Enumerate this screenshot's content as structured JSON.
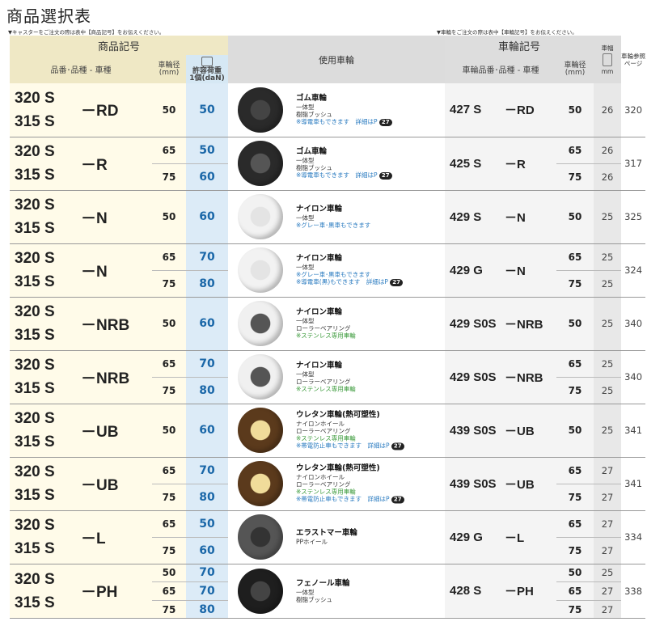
{
  "title": "商品選択表",
  "note_left": "▼キャスターをご注文の際は表中【商品記号】をお伝えください。",
  "note_right": "▼車輪をご注文の際は表中【車輪記号】をお伝えください。",
  "header": {
    "product_code": "商品記号",
    "product_sub": "品番･品種 - 車種",
    "wheel_dia": "車輪径",
    "wheel_dia_unit": "(mm)",
    "load": "許容荷重",
    "load_unit": "1個(daN)",
    "wheel_used": "使用車輪",
    "wheel_code": "車輪記号",
    "wheel_sub": "車輪品番･品種 - 車種",
    "wheel_dia2": "車輪径",
    "wheel_dia2_unit": "(mm)",
    "width": "車幅",
    "width_unit": "mm",
    "ref": "車輪参照ページ"
  },
  "models": [
    "320 S",
    "315 S"
  ],
  "groups": [
    {
      "type": "－RD",
      "sizes": [
        "50"
      ],
      "loads": [
        "50"
      ],
      "wheel_name": "ゴム車輪",
      "lines": [
        "一体型",
        "樹脂ブッシュ"
      ],
      "blue": [
        "※導電車もできます　詳細はP"
      ],
      "badge": "27",
      "green": [],
      "color": "#2a2a2a",
      "hub": "#444",
      "wmodel": "427 S",
      "wtype": "－RD",
      "wsizes": [
        "50"
      ],
      "widths": [
        "26"
      ],
      "page": "320"
    },
    {
      "type": "－R",
      "sizes": [
        "65",
        "75"
      ],
      "loads": [
        "50",
        "60"
      ],
      "wheel_name": "ゴム車輪",
      "lines": [
        "一体型",
        "樹脂ブッシュ"
      ],
      "blue": [
        "※導電車もできます　詳細はP"
      ],
      "badge": "27",
      "green": [],
      "color": "#2a2a2a",
      "hub": "#555",
      "wmodel": "425 S",
      "wtype": "－R",
      "wsizes": [
        "65",
        "75"
      ],
      "widths": [
        "26",
        "26"
      ],
      "page": "317"
    },
    {
      "type": "－N",
      "sizes": [
        "50"
      ],
      "loads": [
        "60"
      ],
      "wheel_name": "ナイロン車輪",
      "lines": [
        "一体型"
      ],
      "blue": [
        "※グレー車･黒車もできます"
      ],
      "badge": "",
      "green": [],
      "color": "#f2f2f2",
      "hub": "#e4e4e4",
      "wmodel": "429 S",
      "wtype": "－N",
      "wsizes": [
        "50"
      ],
      "widths": [
        "25"
      ],
      "page": "325"
    },
    {
      "type": "－N",
      "sizes": [
        "65",
        "75"
      ],
      "loads": [
        "70",
        "80"
      ],
      "wheel_name": "ナイロン車輪",
      "lines": [
        "一体型"
      ],
      "blue": [
        "※グレー車･黒車もできます",
        "※導電車(黒)もできます　詳細はP"
      ],
      "badge": "27",
      "green": [],
      "color": "#f2f2f2",
      "hub": "#e4e4e4",
      "wmodel": "429 G",
      "wtype": "－N",
      "wsizes": [
        "65",
        "75"
      ],
      "widths": [
        "25",
        "25"
      ],
      "page": "324"
    },
    {
      "type": "－NRB",
      "sizes": [
        "50"
      ],
      "loads": [
        "60"
      ],
      "wheel_name": "ナイロン車輪",
      "lines": [
        "一体型",
        "ローラーベアリング"
      ],
      "blue": [],
      "badge": "",
      "green": [
        "※ステンレス専用車輪"
      ],
      "color": "#f0f0f0",
      "hub": "#555",
      "wmodel": "429 S0S",
      "wtype": "－NRB",
      "wsizes": [
        "50"
      ],
      "widths": [
        "25"
      ],
      "page": "340"
    },
    {
      "type": "－NRB",
      "sizes": [
        "65",
        "75"
      ],
      "loads": [
        "70",
        "80"
      ],
      "wheel_name": "ナイロン車輪",
      "lines": [
        "一体型",
        "ローラーベアリング"
      ],
      "blue": [],
      "badge": "",
      "green": [
        "※ステンレス専用車輪"
      ],
      "color": "#f0f0f0",
      "hub": "#555",
      "wmodel": "429 S0S",
      "wtype": "－NRB",
      "wsizes": [
        "65",
        "75"
      ],
      "widths": [
        "25",
        "25"
      ],
      "page": "340"
    },
    {
      "type": "－UB",
      "sizes": [
        "50"
      ],
      "loads": [
        "60"
      ],
      "wheel_name": "ウレタン車輪(熱可塑性)",
      "lines": [
        "ナイロンホイール",
        "ローラーベアリング"
      ],
      "blue": [
        "※帯電防止車もできます　詳細はP"
      ],
      "badge": "27",
      "green": [
        "※ステンレス専用車輪"
      ],
      "color": "#5b3a1c",
      "hub": "#f0dc9a",
      "wmodel": "439 S0S",
      "wtype": "－UB",
      "wsizes": [
        "50"
      ],
      "widths": [
        "25"
      ],
      "page": "341"
    },
    {
      "type": "－UB",
      "sizes": [
        "65",
        "75"
      ],
      "loads": [
        "70",
        "80"
      ],
      "wheel_name": "ウレタン車輪(熱可塑性)",
      "lines": [
        "ナイロンホイール",
        "ローラーベアリング"
      ],
      "blue": [
        "※帯電防止車もできます　詳細はP"
      ],
      "badge": "27",
      "green": [
        "※ステンレス専用車輪"
      ],
      "color": "#5b3a1c",
      "hub": "#f0dc9a",
      "wmodel": "439 S0S",
      "wtype": "－UB",
      "wsizes": [
        "65",
        "75"
      ],
      "widths": [
        "27",
        "27"
      ],
      "page": "341"
    },
    {
      "type": "－L",
      "sizes": [
        "65",
        "75"
      ],
      "loads": [
        "50",
        "60"
      ],
      "wheel_name": "エラストマー車輪",
      "lines": [
        "PPホイール"
      ],
      "blue": [],
      "badge": "",
      "green": [],
      "color": "#555",
      "hub": "#333",
      "wmodel": "429 G",
      "wtype": "－L",
      "wsizes": [
        "65",
        "75"
      ],
      "widths": [
        "27",
        "27"
      ],
      "page": "334"
    },
    {
      "type": "－PH",
      "sizes": [
        "50",
        "65",
        "75"
      ],
      "loads": [
        "70",
        "70",
        "80"
      ],
      "wheel_name": "フェノール車輪",
      "lines": [
        "一体型",
        "樹脂ブッシュ"
      ],
      "blue": [],
      "badge": "",
      "green": [],
      "color": "#1e1e1e",
      "hub": "#444",
      "wmodel": "428 S",
      "wtype": "－PH",
      "wsizes": [
        "50",
        "65",
        "75"
      ],
      "widths": [
        "25",
        "27",
        "27"
      ],
      "page": "338"
    }
  ]
}
